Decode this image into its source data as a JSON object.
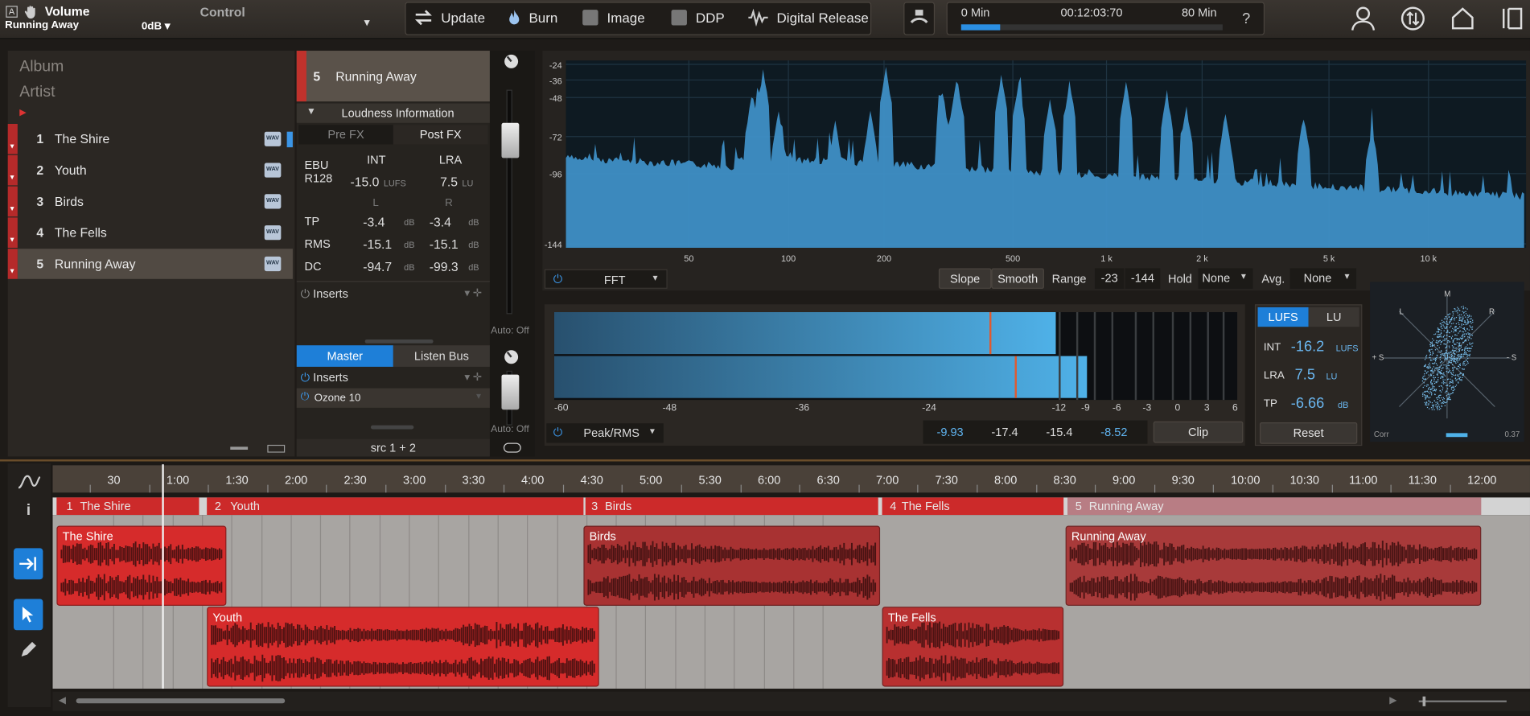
{
  "header": {
    "mode_label": "A",
    "volume_label": "Volume",
    "track_name": "Running Away",
    "gain": "0dB",
    "control_label": "Control"
  },
  "toolbar": {
    "update": "Update",
    "burn": "Burn",
    "image": "Image",
    "ddp": "DDP",
    "digital_release": "Digital Release"
  },
  "transport": {
    "start": "0 Min",
    "time": "00:12:03:70",
    "end": "80 Min",
    "help": "?",
    "progress": 0.15
  },
  "album": {
    "album_label": "Album",
    "artist_label": "Artist",
    "wav_badge": "WAV",
    "tracks": [
      {
        "num": "1",
        "name": "The Shire"
      },
      {
        "num": "2",
        "name": "Youth"
      },
      {
        "num": "3",
        "name": "Birds"
      },
      {
        "num": "4",
        "name": "The Fells"
      },
      {
        "num": "5",
        "name": "Running Away"
      }
    ]
  },
  "inspector": {
    "track_num": "5",
    "track_name": "Running Away",
    "loudness_title": "Loudness Information",
    "pre_fx": "Pre FX",
    "post_fx": "Post FX",
    "ebu": "EBU",
    "r128": "R128",
    "int_hdr": "INT",
    "lra_hdr": "LRA",
    "int_val": "-15.0",
    "int_unit": "LUFS",
    "lra_val": "7.5",
    "lra_unit": "LU",
    "l_hdr": "L",
    "r_hdr": "R",
    "rows": [
      {
        "label": "TP",
        "l": "-3.4",
        "r": "-3.4",
        "unit": "dB"
      },
      {
        "label": "RMS",
        "l": "-15.1",
        "r": "-15.1",
        "unit": "dB"
      },
      {
        "label": "DC",
        "l": "-94.7",
        "r": "-99.3",
        "unit": "dB"
      }
    ],
    "inserts": "Inserts",
    "auto_off": "Auto: Off"
  },
  "master": {
    "master_tab": "Master",
    "listen_tab": "Listen Bus",
    "inserts": "Inserts",
    "plugin": "Ozone 10",
    "src": "src 1 + 2",
    "auto_off": "Auto: Off"
  },
  "spectrum": {
    "y_ticks": [
      "-24",
      "-36",
      "-48",
      "-72",
      "-96",
      "-144"
    ],
    "x_ticks": [
      "50",
      "100",
      "200",
      "500",
      "1 k",
      "2 k",
      "5 k",
      "10 k"
    ],
    "mode": "FFT",
    "slope": "Slope",
    "smooth": "Smooth",
    "range_label": "Range",
    "range_hi": "-23",
    "range_lo": "-144",
    "hold_label": "Hold",
    "hold_val": "None",
    "avg_label": "Avg.",
    "avg_val": "None"
  },
  "meter": {
    "scale": [
      "-60",
      "-48",
      "-36",
      "-24",
      "-12",
      "-9",
      "-6",
      "-3",
      "0",
      "3",
      "6"
    ],
    "mode": "Peak/RMS",
    "readouts": [
      "-9.93",
      "-17.4",
      "-15.4",
      "-8.52"
    ],
    "clip": "Clip",
    "bar_l": 0.79,
    "bar_r": 0.84
  },
  "loudness": {
    "tab_lufs": "LUFS",
    "tab_lu": "LU",
    "int_label": "INT",
    "int_val": "-16.2",
    "int_unit": "LUFS",
    "lra_label": "LRA",
    "lra_val": "7.5",
    "lra_unit": "LU",
    "tp_label": "TP",
    "tp_val": "-6.66",
    "tp_unit": "dB",
    "reset": "Reset"
  },
  "scope": {
    "m": "M",
    "l": "L",
    "r": "R",
    "ps": "+ S",
    "ms": "- S",
    "corr": "Corr",
    "corr_val": "0.37"
  },
  "timeline": {
    "ruler": [
      "30",
      "1:00",
      "1:30",
      "2:00",
      "2:30",
      "3:00",
      "3:30",
      "4:00",
      "4:30",
      "5:00",
      "5:30",
      "6:00",
      "6:30",
      "7:00",
      "7:30",
      "8:00",
      "8:30",
      "9:00",
      "9:30",
      "10:00",
      "10:30",
      "11:00",
      "11:30",
      "12:00"
    ],
    "markers": [
      {
        "num": "1",
        "name": "The Shire"
      },
      {
        "num": "2",
        "name": "Youth"
      },
      {
        "num": "3",
        "name": "Birds"
      },
      {
        "num": "4",
        "name": "The Fells"
      },
      {
        "num": "5",
        "name": "Running Away"
      }
    ],
    "clips": {
      "shire": "The Shire",
      "youth": "Youth",
      "birds": "Birds",
      "fells": "The Fells",
      "running": "Running Away"
    }
  },
  "colors": {
    "accent": "#1e7fd8",
    "track_red": "#d32a2a",
    "meter_blue": "#4fb1e8"
  }
}
